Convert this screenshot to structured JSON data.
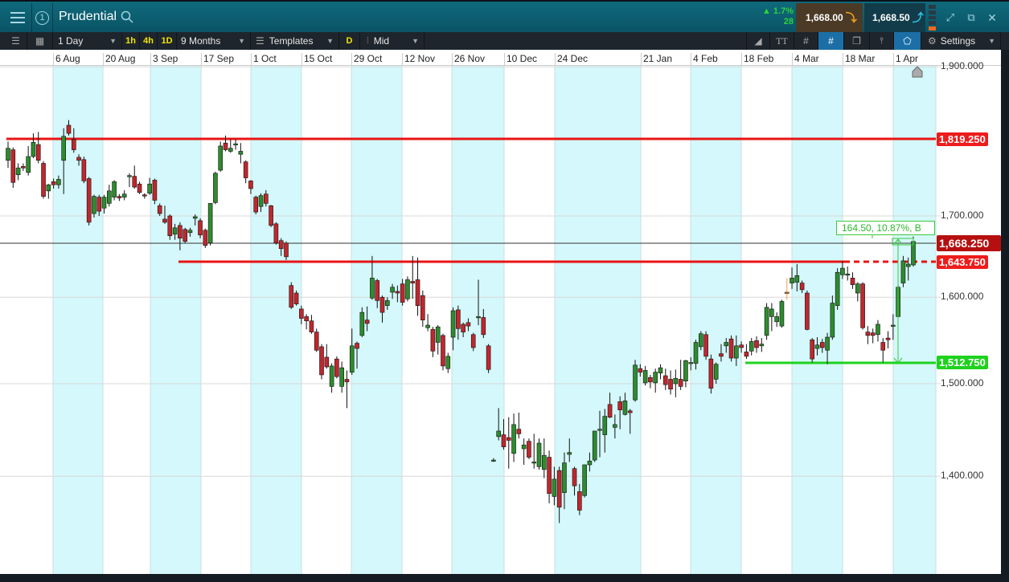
{
  "header": {
    "instrument": "Prudential",
    "account_index": "1",
    "change_pct": "1.7%",
    "change_points": "28",
    "sell_price": "1,668.00",
    "buy_price": "1,668.50"
  },
  "toolbar": {
    "interval": "1 Day",
    "quick": [
      "1h",
      "4h",
      "1D"
    ],
    "range": "9 Months",
    "templates": "Templates",
    "d_label": "D",
    "price_type": "Mid",
    "settings": "Settings"
  },
  "colors": {
    "accent": "#1b6fa6",
    "up": "#2e8b2e",
    "down": "#c0272d",
    "band": "#d4f8fb",
    "resistance": "#e81414",
    "support": "#1ed21e"
  },
  "chart_data": {
    "type": "candlestick",
    "x_labels": [
      "6 Aug",
      "20 Aug",
      "3 Sep",
      "17 Sep",
      "1 Oct",
      "15 Oct",
      "29 Oct",
      "12 Nov",
      "26 Nov",
      "10 Dec",
      "24 Dec",
      "21 Jan",
      "4 Feb",
      "18 Feb",
      "4 Mar",
      "18 Mar",
      "1 Apr"
    ],
    "y_ticks": [
      "1,900.000",
      "1,700.000",
      "1,600.000",
      "1,500.000",
      "1,400.000"
    ],
    "y_tick_values": [
      1900,
      1700,
      1600,
      1500,
      1400
    ],
    "scale": "log",
    "price_tags": {
      "resistance_high": "1,819.250",
      "current": "1,668.250",
      "resistance": "1,643.750",
      "support": "1,512.750"
    },
    "measure_label": "164.50, 10.87%, B",
    "ohlc": [
      [
        1772,
        1797,
        1762,
        1788
      ],
      [
        1786,
        1789,
        1736,
        1743
      ],
      [
        1753,
        1768,
        1746,
        1762
      ],
      [
        1764,
        1768,
        1758,
        1762
      ],
      [
        1756,
        1791,
        1752,
        1777
      ],
      [
        1777,
        1808,
        1775,
        1796
      ],
      [
        1793,
        1810,
        1768,
        1772
      ],
      [
        1768,
        1771,
        1722,
        1725
      ],
      [
        1732,
        1741,
        1722,
        1740
      ],
      [
        1744,
        1748,
        1735,
        1740
      ],
      [
        1740,
        1752,
        1735,
        1747
      ],
      [
        1772,
        1815,
        1728,
        1804
      ],
      [
        1819,
        1826,
        1805,
        1808
      ],
      [
        1800,
        1815,
        1782,
        1786
      ],
      [
        1776,
        1780,
        1765,
        1772
      ],
      [
        1773,
        1777,
        1742,
        1745
      ],
      [
        1748,
        1750,
        1688,
        1692
      ],
      [
        1703,
        1727,
        1698,
        1725
      ],
      [
        1724,
        1727,
        1700,
        1706
      ],
      [
        1710,
        1727,
        1703,
        1724
      ],
      [
        1716,
        1740,
        1712,
        1732
      ],
      [
        1724,
        1746,
        1720,
        1744
      ],
      [
        1725,
        1728,
        1719,
        1723
      ],
      [
        1724,
        1733,
        1720,
        1728
      ],
      [
        1751,
        1755,
        1737,
        1752
      ],
      [
        1751,
        1765,
        1735,
        1737
      ],
      [
        1741,
        1744,
        1728,
        1730
      ],
      [
        1727,
        1729,
        1722,
        1726
      ],
      [
        1729,
        1749,
        1727,
        1741
      ],
      [
        1746,
        1748,
        1715,
        1720
      ],
      [
        1713,
        1716,
        1700,
        1703
      ],
      [
        1696,
        1713,
        1690,
        1692
      ],
      [
        1700,
        1702,
        1670,
        1675
      ],
      [
        1677,
        1690,
        1670,
        1685
      ],
      [
        1688,
        1692,
        1657,
        1672
      ],
      [
        1683,
        1685,
        1666,
        1668
      ],
      [
        1679,
        1685,
        1674,
        1682
      ],
      [
        1697,
        1702,
        1688,
        1699
      ],
      [
        1694,
        1697,
        1672,
        1676
      ],
      [
        1682,
        1684,
        1660,
        1663
      ],
      [
        1666,
        1716,
        1663,
        1716
      ],
      [
        1717,
        1757,
        1715,
        1755
      ],
      [
        1759,
        1797,
        1757,
        1791
      ],
      [
        1795,
        1805,
        1784,
        1786
      ],
      [
        1784,
        1800,
        1782,
        1788
      ],
      [
        1793,
        1800,
        1786,
        1794
      ],
      [
        1780,
        1795,
        1768,
        1784
      ],
      [
        1770,
        1772,
        1742,
        1749
      ],
      [
        1745,
        1746,
        1728,
        1735
      ],
      [
        1724,
        1726,
        1702,
        1705
      ],
      [
        1712,
        1729,
        1705,
        1726
      ],
      [
        1728,
        1733,
        1712,
        1716
      ],
      [
        1713,
        1714,
        1686,
        1688
      ],
      [
        1690,
        1692,
        1664,
        1666
      ],
      [
        1669,
        1672,
        1650,
        1659
      ],
      [
        1666,
        1668,
        1645,
        1649
      ],
      [
        1614,
        1618,
        1586,
        1588
      ],
      [
        1605,
        1608,
        1590,
        1592
      ],
      [
        1586,
        1590,
        1568,
        1575
      ],
      [
        1577,
        1580,
        1562,
        1572
      ],
      [
        1572,
        1579,
        1557,
        1559
      ],
      [
        1559,
        1563,
        1536,
        1538
      ],
      [
        1542,
        1545,
        1505,
        1510
      ],
      [
        1530,
        1545,
        1517,
        1519
      ],
      [
        1497,
        1523,
        1490,
        1520
      ],
      [
        1528,
        1531,
        1506,
        1508
      ],
      [
        1497,
        1525,
        1490,
        1518
      ],
      [
        1505,
        1515,
        1473,
        1502
      ],
      [
        1513,
        1563,
        1510,
        1543
      ],
      [
        1546,
        1548,
        1517,
        1540
      ],
      [
        1555,
        1588,
        1553,
        1582
      ],
      [
        1573,
        1589,
        1560,
        1569
      ],
      [
        1599,
        1650,
        1597,
        1623
      ],
      [
        1620,
        1622,
        1587,
        1596
      ],
      [
        1600,
        1602,
        1570,
        1582
      ],
      [
        1590,
        1600,
        1585,
        1596
      ],
      [
        1606,
        1616,
        1598,
        1612
      ],
      [
        1607,
        1614,
        1594,
        1605
      ],
      [
        1616,
        1622,
        1590,
        1594
      ],
      [
        1598,
        1625,
        1595,
        1621
      ],
      [
        1619,
        1650,
        1598,
        1617
      ],
      [
        1621,
        1648,
        1578,
        1590
      ],
      [
        1602,
        1608,
        1565,
        1573
      ],
      [
        1564,
        1580,
        1560,
        1567
      ],
      [
        1562,
        1565,
        1530,
        1537
      ],
      [
        1547,
        1567,
        1533,
        1565
      ],
      [
        1555,
        1557,
        1515,
        1520
      ],
      [
        1517,
        1535,
        1512,
        1531
      ],
      [
        1553,
        1588,
        1538,
        1584
      ],
      [
        1585,
        1590,
        1550,
        1563
      ],
      [
        1568,
        1570,
        1553,
        1559
      ],
      [
        1570,
        1575,
        1560,
        1566
      ],
      [
        1556,
        1558,
        1537,
        1541
      ],
      [
        1577,
        1621,
        1567,
        1577
      ],
      [
        1576,
        1586,
        1552,
        1556
      ],
      [
        1543,
        1545,
        1512,
        1516
      ],
      [
        1417,
        1419,
        1415,
        1417
      ],
      [
        1442,
        1473,
        1438,
        1448
      ],
      [
        1444,
        1461,
        1428,
        1431
      ],
      [
        1441,
        1463,
        1408,
        1438
      ],
      [
        1424,
        1467,
        1415,
        1455
      ],
      [
        1450,
        1468,
        1440,
        1445
      ],
      [
        1429,
        1440,
        1412,
        1433
      ],
      [
        1437,
        1440,
        1418,
        1420
      ],
      [
        1415,
        1445,
        1408,
        1415
      ],
      [
        1410,
        1440,
        1407,
        1435
      ],
      [
        1407,
        1440,
        1398,
        1422
      ],
      [
        1420,
        1427,
        1372,
        1382
      ],
      [
        1379,
        1410,
        1370,
        1397
      ],
      [
        1406,
        1410,
        1352,
        1368
      ],
      [
        1383,
        1425,
        1366,
        1414
      ],
      [
        1423,
        1440,
        1415,
        1425
      ],
      [
        1408,
        1410,
        1380,
        1390
      ],
      [
        1384,
        1392,
        1360,
        1365
      ],
      [
        1380,
        1412,
        1378,
        1412
      ],
      [
        1412,
        1425,
        1405,
        1416
      ],
      [
        1417,
        1448,
        1415,
        1448
      ],
      [
        1450,
        1470,
        1420,
        1450
      ],
      [
        1444,
        1472,
        1425,
        1464
      ],
      [
        1477,
        1490,
        1462,
        1463
      ],
      [
        1452,
        1466,
        1440,
        1455
      ],
      [
        1480,
        1486,
        1450,
        1471
      ],
      [
        1466,
        1490,
        1465,
        1481
      ],
      [
        1470,
        1472,
        1445,
        1468
      ],
      [
        1482,
        1527,
        1480,
        1521
      ],
      [
        1517,
        1522,
        1508,
        1513
      ],
      [
        1501,
        1520,
        1498,
        1515
      ],
      [
        1507,
        1510,
        1495,
        1502
      ],
      [
        1501,
        1517,
        1490,
        1513
      ],
      [
        1512,
        1522,
        1505,
        1518
      ],
      [
        1509,
        1517,
        1493,
        1499
      ],
      [
        1505,
        1515,
        1488,
        1494
      ],
      [
        1500,
        1516,
        1485,
        1506
      ],
      [
        1505,
        1527,
        1493,
        1497
      ],
      [
        1503,
        1527,
        1496,
        1526
      ],
      [
        1524,
        1530,
        1515,
        1524
      ],
      [
        1523,
        1550,
        1516,
        1547
      ],
      [
        1542,
        1560,
        1538,
        1557
      ],
      [
        1556,
        1560,
        1527,
        1531
      ],
      [
        1528,
        1533,
        1489,
        1495
      ],
      [
        1505,
        1524,
        1500,
        1522
      ],
      [
        1534,
        1545,
        1525,
        1531
      ],
      [
        1543,
        1552,
        1535,
        1547
      ],
      [
        1551,
        1555,
        1525,
        1529
      ],
      [
        1529,
        1555,
        1520,
        1543
      ],
      [
        1544,
        1548,
        1535,
        1541
      ],
      [
        1536,
        1545,
        1528,
        1531
      ],
      [
        1537,
        1552,
        1532,
        1548
      ],
      [
        1549,
        1554,
        1535,
        1541
      ],
      [
        1543,
        1552,
        1536,
        1545
      ],
      [
        1555,
        1593,
        1550,
        1588
      ],
      [
        1577,
        1593,
        1560,
        1586
      ],
      [
        1571,
        1582,
        1565,
        1577
      ],
      [
        1566,
        1597,
        1564,
        1595
      ],
      [
        1606,
        1623,
        1597,
        1606
      ],
      [
        1617,
        1636,
        1610,
        1623
      ],
      [
        1618,
        1640,
        1607,
        1626
      ],
      [
        1617,
        1620,
        1605,
        1609
      ],
      [
        1605,
        1608,
        1561,
        1562
      ],
      [
        1550,
        1552,
        1524,
        1528
      ],
      [
        1540,
        1553,
        1532,
        1544
      ],
      [
        1547,
        1551,
        1535,
        1541
      ],
      [
        1538,
        1558,
        1522,
        1553
      ],
      [
        1553,
        1602,
        1550,
        1593
      ],
      [
        1590,
        1635,
        1585,
        1630
      ],
      [
        1627,
        1644,
        1622,
        1635
      ],
      [
        1628,
        1637,
        1620,
        1628
      ],
      [
        1623,
        1630,
        1610,
        1615
      ],
      [
        1605,
        1618,
        1595,
        1616
      ],
      [
        1616,
        1618,
        1562,
        1564
      ],
      [
        1559,
        1566,
        1545,
        1555
      ],
      [
        1558,
        1563,
        1546,
        1555
      ],
      [
        1556,
        1573,
        1548,
        1568
      ],
      [
        1547,
        1552,
        1524,
        1538
      ],
      [
        1552,
        1560,
        1540,
        1550
      ],
      [
        1567,
        1580,
        1550,
        1567
      ],
      [
        1577,
        1615,
        1576,
        1612
      ],
      [
        1617,
        1650,
        1612,
        1644
      ],
      [
        1637,
        1648,
        1620,
        1640
      ],
      [
        1639,
        1674,
        1637,
        1668
      ]
    ],
    "highlighted_candle_index": 154
  }
}
